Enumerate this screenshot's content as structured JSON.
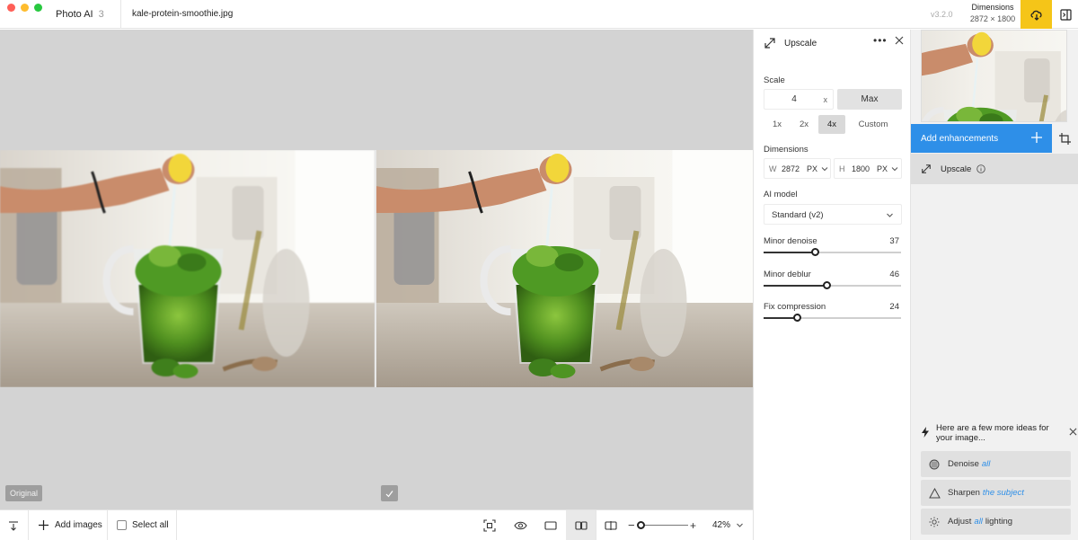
{
  "app": {
    "name": "Photo AI",
    "version_short": "3",
    "file_name": "kale-protein-smoothie.jpg",
    "version": "v3.2.0"
  },
  "dimensions": {
    "label": "Dimensions",
    "value": "2872 × 1800"
  },
  "canvas": {
    "original_label": "Original"
  },
  "toolbar": {
    "add_images": "Add images",
    "select_all": "Select all",
    "zoom": "42%"
  },
  "upscale": {
    "title": "Upscale",
    "scale_label": "Scale",
    "scale_value": "4",
    "scale_suffix": "x",
    "max_label": "Max",
    "presets": [
      "1x",
      "2x",
      "4x",
      "Custom"
    ],
    "active_preset": "4x",
    "dimensions_label": "Dimensions",
    "width_label": "W",
    "width_value": "2872",
    "height_label": "H",
    "height_value": "1800",
    "unit": "PX",
    "ai_model_label": "AI model",
    "ai_model_value": "Standard (v2)",
    "sliders": [
      {
        "label": "Minor denoise",
        "value": 37
      },
      {
        "label": "Minor deblur",
        "value": 46
      },
      {
        "label": "Fix compression",
        "value": 24
      }
    ]
  },
  "enhancements": {
    "add_label": "Add enhancements",
    "items": [
      {
        "label": "Upscale"
      }
    ]
  },
  "ideas": {
    "heading": "Here are a few more ideas for your image...",
    "items": [
      {
        "pre": "Denoise",
        "highlight": "all",
        "post": ""
      },
      {
        "pre": "Sharpen",
        "highlight": "the subject",
        "post": ""
      },
      {
        "pre": "Adjust",
        "highlight": "all",
        "post": "lighting"
      }
    ]
  },
  "colors": {
    "accent": "#2e8fe8",
    "export": "#f5c518",
    "canvas_bg": "#d3d3d3"
  }
}
